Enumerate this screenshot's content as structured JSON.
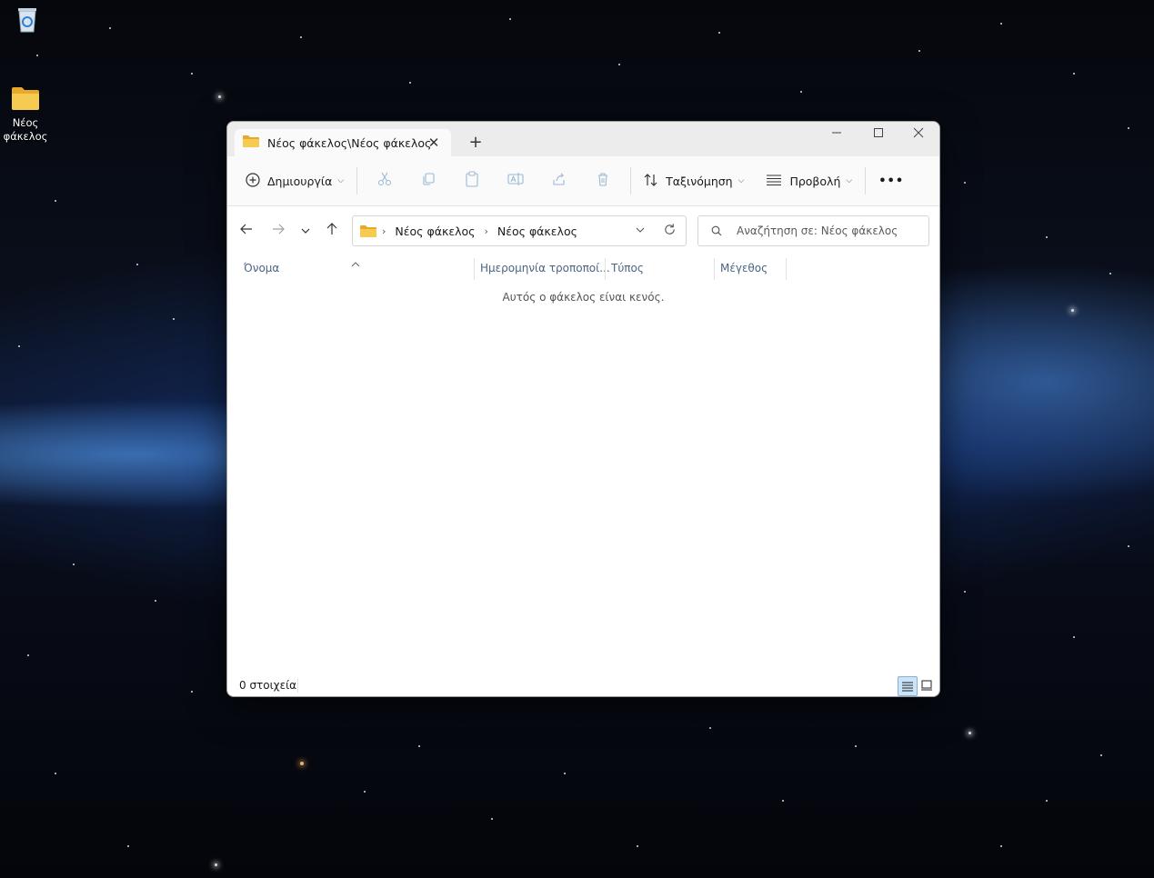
{
  "desktop": {
    "recycle_bin_label": "",
    "folder_icon_label": "Νέος φάκελος"
  },
  "window": {
    "tab_title": "Νέος φάκελος\\Νέος φάκελος",
    "new_tab_symbol": "+",
    "toolbar": {
      "new_label": "Δημιουργία",
      "sort_label": "Ταξινόμηση",
      "view_label": "Προβολή",
      "more_label": "•••"
    },
    "address": {
      "crumbs": [
        "Νέος φάκελος",
        "Νέος φάκελος"
      ]
    },
    "search": {
      "placeholder": "Αναζήτηση σε: Νέος φάκελος"
    },
    "columns": [
      "Όνομα",
      "Ημερομηνία τροποποί...",
      "Τύπος",
      "Μέγεθος"
    ],
    "empty_message": "Αυτός ο φάκελος είναι κενός.",
    "status": {
      "item_count": "0 στοιχεία"
    }
  },
  "colors": {
    "accent": "#0067c0",
    "folder": "#f5c244",
    "column_text": "#4a6580"
  },
  "icons": [
    "recycle-bin-icon",
    "folder-icon",
    "plus-circle-icon",
    "cut-icon",
    "copy-icon",
    "paste-icon",
    "rename-icon",
    "share-icon",
    "delete-icon",
    "sort-icon",
    "view-icon",
    "back-icon",
    "forward-icon",
    "recent-icon",
    "up-icon",
    "refresh-icon",
    "search-icon",
    "details-view-icon",
    "tiles-view-icon"
  ]
}
